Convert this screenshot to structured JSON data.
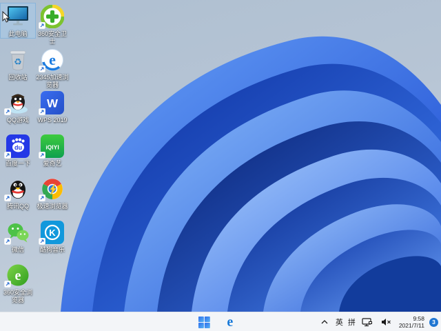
{
  "desktop": {
    "wallpaper_name": "windows-11-bloom",
    "background_top": "#aebfd1",
    "background_bottom": "#ccd7e2",
    "bloom_blue_dark": "#0a2f9e",
    "bloom_blue_light": "#9cc4fb",
    "icons": [
      {
        "label": "此电脑",
        "icon": "this-pc",
        "col": 1,
        "row": 1,
        "shortcut": false,
        "selected": true
      },
      {
        "label": "360安全卫士",
        "icon": "360-safety",
        "col": 2,
        "row": 1,
        "shortcut": true,
        "selected": false
      },
      {
        "label": "回收站",
        "icon": "recycle-bin",
        "col": 1,
        "row": 2,
        "shortcut": false,
        "selected": false
      },
      {
        "label": "2345加速浏览器",
        "icon": "2345-browser",
        "col": 2,
        "row": 2,
        "shortcut": true,
        "selected": false
      },
      {
        "label": "QQ游戏",
        "icon": "qq-game",
        "col": 1,
        "row": 3,
        "shortcut": true,
        "selected": false
      },
      {
        "label": "WPS 2019",
        "icon": "wps",
        "col": 2,
        "row": 3,
        "shortcut": true,
        "selected": false
      },
      {
        "label": "百度一下",
        "icon": "baidu",
        "col": 1,
        "row": 4,
        "shortcut": true,
        "selected": false
      },
      {
        "label": "爱奇艺",
        "icon": "iqiyi",
        "col": 2,
        "row": 4,
        "shortcut": true,
        "selected": false
      },
      {
        "label": "腾讯QQ",
        "icon": "tencent-qq",
        "col": 1,
        "row": 5,
        "shortcut": true,
        "selected": false
      },
      {
        "label": "极速浏览器",
        "icon": "speed-browser",
        "col": 2,
        "row": 5,
        "shortcut": true,
        "selected": false
      },
      {
        "label": "微信",
        "icon": "wechat",
        "col": 1,
        "row": 6,
        "shortcut": true,
        "selected": false
      },
      {
        "label": "酷狗音乐",
        "icon": "kugou",
        "col": 2,
        "row": 6,
        "shortcut": true,
        "selected": false
      },
      {
        "label": "360安全浏览器",
        "icon": "360-browser",
        "col": 1,
        "row": 7,
        "shortcut": true,
        "selected": false
      }
    ]
  },
  "taskbar": {
    "background": "#f3f5f8",
    "center_icons": [
      "start",
      "edge-browser"
    ],
    "tray": {
      "hidden_icons": "chevron-up",
      "ime_lang": "英",
      "ime_mode": "拼",
      "network_icon": "ethernet-monitor",
      "volume_icon": "speaker-muted",
      "time": "9:58",
      "date": "2021/7/11",
      "badge_count": "3",
      "badge_color": "#1f76d2"
    }
  }
}
